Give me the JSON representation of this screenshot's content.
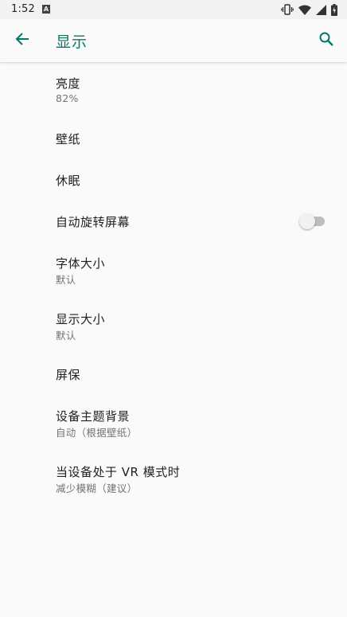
{
  "status_bar": {
    "time": "1:52",
    "notification_icon": "a-icon",
    "icons": [
      "vibrate-icon",
      "wifi-icon",
      "cell-signal-icon",
      "battery-icon"
    ]
  },
  "app_bar": {
    "title": "显示",
    "back_icon": "arrow-back-icon",
    "search_icon": "search-icon",
    "accent_color": "#00796b"
  },
  "settings": {
    "items": [
      {
        "title": "亮度",
        "summary": "82%"
      },
      {
        "title": "壁纸",
        "summary": ""
      },
      {
        "title": "休眠",
        "summary": ""
      },
      {
        "title": "自动旋转屏幕",
        "summary": "",
        "toggle": false
      },
      {
        "title": "字体大小",
        "summary": "默认"
      },
      {
        "title": "显示大小",
        "summary": "默认"
      },
      {
        "title": "屏保",
        "summary": ""
      },
      {
        "title": "设备主题背景",
        "summary": "自动（根据壁纸）"
      },
      {
        "title": "当设备处于 VR 模式时",
        "summary": "减少模糊（建议）"
      }
    ]
  }
}
